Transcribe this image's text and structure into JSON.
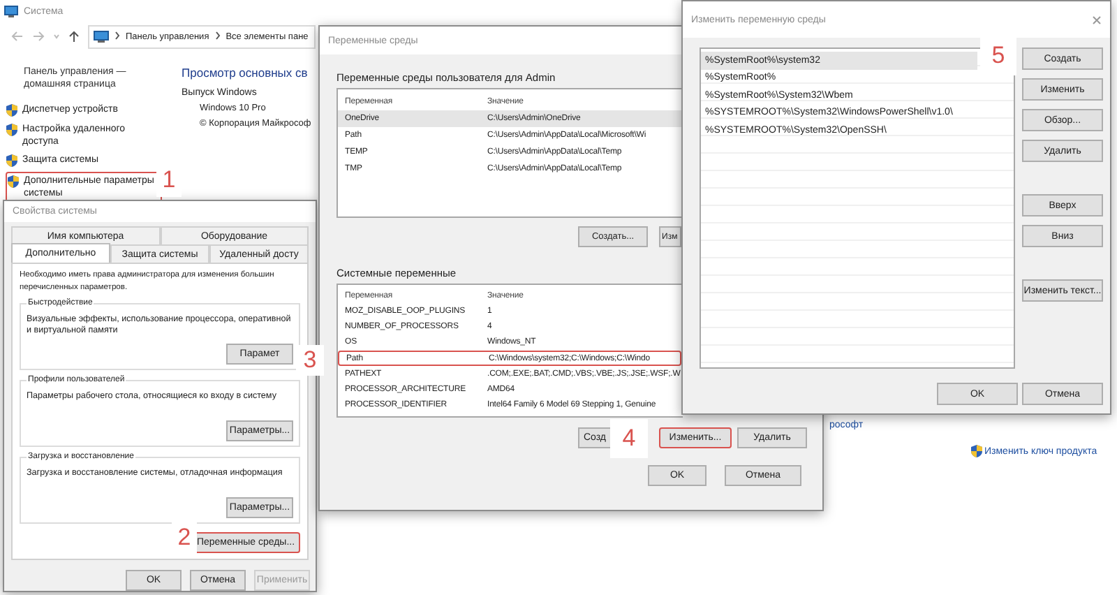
{
  "control_panel": {
    "title": "Система",
    "breadcrumbs": [
      "Панель управления",
      "Все элементы пане"
    ],
    "home_link": "Панель управления — домашняя страница",
    "sidebar": {
      "items": [
        {
          "label": "Диспетчер устройств",
          "highlighted": false
        },
        {
          "label": "Настройка удаленного доступа",
          "highlighted": false
        },
        {
          "label": "Защита системы",
          "highlighted": false
        },
        {
          "label": "Дополнительные параметры системы",
          "highlighted": true
        }
      ]
    },
    "heading": "Просмотр основных св",
    "edition_label": "Выпуск Windows",
    "edition": "Windows 10 Pro",
    "copyright": "© Корпорация Майкрософ",
    "link_fragment": "рософт",
    "product_key_link": "Изменить ключ продукта"
  },
  "system_properties": {
    "title": "Свойства системы",
    "tab_rows": [
      {
        "tabs": [
          {
            "label": "Имя компьютера",
            "selected": false
          },
          {
            "label": "Оборудование",
            "selected": false
          }
        ]
      },
      {
        "tabs": [
          {
            "label": "Дополнительно",
            "selected": true
          },
          {
            "label": "Защита системы",
            "selected": false
          },
          {
            "label": "Удаленный досту",
            "selected": false
          }
        ]
      }
    ],
    "note_lines": [
      "Необходимо иметь права администратора для изменения большин",
      "перечисленных параметров."
    ],
    "groups": [
      {
        "title": "Быстродействие",
        "description": "Визуальные эффекты, использование процессора, оперативной и виртуальной памяти",
        "button": "Парамет"
      },
      {
        "title": "Профили пользователей",
        "description": "Параметры рабочего стола, относящиеся ко входу в систему",
        "button": "Параметры..."
      },
      {
        "title": "Загрузка и восстановление",
        "description": "Загрузка и восстановление системы, отладочная информация",
        "button": "Параметры..."
      }
    ],
    "env_button": {
      "label": "Переменные среды...",
      "highlighted": true
    },
    "buttons": [
      {
        "label": "OK",
        "disabled": false
      },
      {
        "label": "Отмена",
        "disabled": false
      },
      {
        "label": "Применить",
        "disabled": true
      }
    ]
  },
  "environment_variables": {
    "title": "Переменные среды",
    "user_section": {
      "label": "Переменные среды пользователя для Admin",
      "columns": [
        "Переменная",
        "Значение"
      ],
      "rows": [
        {
          "name": "OneDrive",
          "value": "C:\\Users\\Admin\\OneDrive",
          "selected": true
        },
        {
          "name": "Path",
          "value": "C:\\Users\\Admin\\AppData\\Local\\Microsoft\\Wi",
          "selected": false
        },
        {
          "name": "TEMP",
          "value": "C:\\Users\\Admin\\AppData\\Local\\Temp",
          "selected": false
        },
        {
          "name": "TMP",
          "value": "C:\\Users\\Admin\\AppData\\Local\\Temp",
          "selected": false
        }
      ],
      "buttons": [
        "Создать...",
        "Изм"
      ]
    },
    "system_section": {
      "label": "Системные переменные",
      "columns": [
        "Переменная",
        "Значение"
      ],
      "rows": [
        {
          "name": "MOZ_DISABLE_OOP_PLUGINS",
          "value": "1",
          "highlighted": false
        },
        {
          "name": "NUMBER_OF_PROCESSORS",
          "value": "4",
          "highlighted": false
        },
        {
          "name": "OS",
          "value": "Windows_NT",
          "highlighted": false
        },
        {
          "name": "Path",
          "value": "C:\\Windows\\system32;C:\\Windows;C:\\Windo",
          "highlighted": true
        },
        {
          "name": "PATHEXT",
          "value": ".COM;.EXE;.BAT;.CMD;.VBS;.VBE;.JS;.JSE;.WSF;.W",
          "highlighted": false
        },
        {
          "name": "PROCESSOR_ARCHITECTURE",
          "value": "AMD64",
          "highlighted": false
        },
        {
          "name": "PROCESSOR_IDENTIFIER",
          "value": "Intel64 Family 6 Model 69 Stepping 1, Genuine",
          "highlighted": false
        }
      ],
      "buttons": [
        {
          "label": "Созд",
          "highlighted": false
        },
        {
          "label": "Изменить...",
          "highlighted": true
        },
        {
          "label": "Удалить",
          "highlighted": false
        }
      ]
    },
    "buttons": [
      "OK",
      "Отмена"
    ]
  },
  "edit_variable": {
    "title": "Изменить переменную среды",
    "entries": [
      {
        "text": "%SystemRoot%\\system32",
        "selected": true
      },
      {
        "text": "%SystemRoot%",
        "selected": false
      },
      {
        "text": "%SystemRoot%\\System32\\Wbem",
        "selected": false
      },
      {
        "text": "%SYSTEMROOT%\\System32\\WindowsPowerShell\\v1.0\\",
        "selected": false
      },
      {
        "text": "%SYSTEMROOT%\\System32\\OpenSSH\\",
        "selected": false
      }
    ],
    "buttons": [
      "Создать",
      "Изменить",
      "Обзор...",
      "Удалить",
      "Вверх",
      "Вниз",
      "Изменить текст..."
    ],
    "footer_buttons": [
      "OK",
      "Отмена"
    ]
  },
  "step_markers": [
    {
      "label": "1"
    },
    {
      "label": "2"
    },
    {
      "label": "3"
    },
    {
      "label": "4"
    },
    {
      "label": "5"
    }
  ]
}
